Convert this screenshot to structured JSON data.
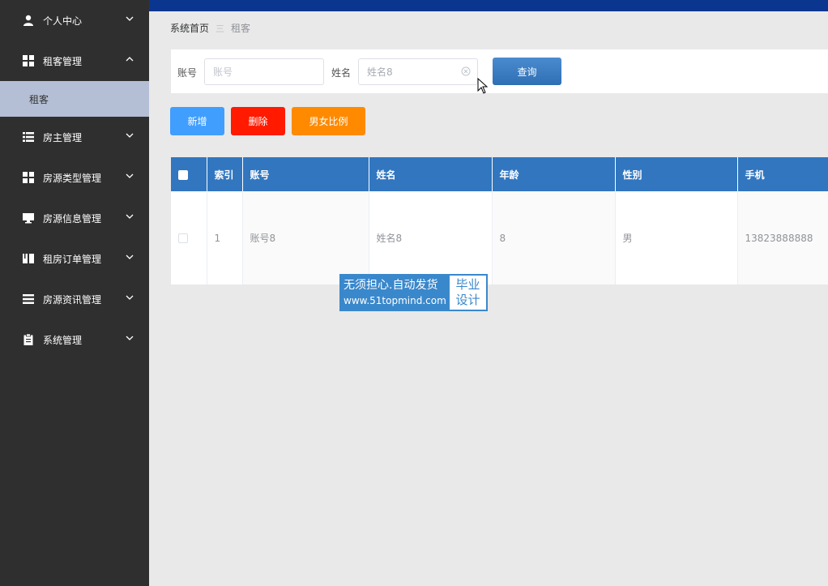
{
  "sidebar": {
    "items": [
      {
        "label": "个人中心",
        "icon": "user-icon"
      },
      {
        "label": "租客管理",
        "icon": "grid-icon",
        "expanded": true,
        "children": [
          {
            "label": "租客"
          }
        ]
      },
      {
        "label": "房主管理",
        "icon": "list-icon"
      },
      {
        "label": "房源类型管理",
        "icon": "grid-icon"
      },
      {
        "label": "房源信息管理",
        "icon": "monitor-icon"
      },
      {
        "label": "租房订单管理",
        "icon": "book-icon"
      },
      {
        "label": "房源资讯管理",
        "icon": "list-icon"
      },
      {
        "label": "系统管理",
        "icon": "clipboard-icon"
      }
    ]
  },
  "breadcrumb": {
    "home": "系统首页",
    "separator": "三",
    "current": "租客"
  },
  "search": {
    "account_label": "账号",
    "account_placeholder": "账号",
    "name_label": "姓名",
    "name_value": "姓名8",
    "query_button": "查询"
  },
  "actions": {
    "add": "新增",
    "delete": "删除",
    "ratio": "男女比例"
  },
  "table": {
    "headers": [
      "索引",
      "账号",
      "姓名",
      "年龄",
      "性别",
      "手机"
    ],
    "rows": [
      {
        "index": "1",
        "account": "账号8",
        "name": "姓名8",
        "age": "8",
        "gender": "男",
        "phone": "13823888888"
      }
    ]
  },
  "watermark": {
    "line1": "无须担心.自动发货",
    "line2": "www.51topmind.com",
    "right1": "毕业",
    "right2": "设计"
  },
  "colors": {
    "sidebar_bg": "#2f2f2f",
    "submenu_active_bg": "#b4bfd6",
    "topbar": "#0a3690",
    "table_header": "#3176bf",
    "add_button": "#409eff",
    "delete_button": "#ff1a00",
    "ratio_button": "#ff8a00",
    "query_button": "#3a7cc4"
  }
}
